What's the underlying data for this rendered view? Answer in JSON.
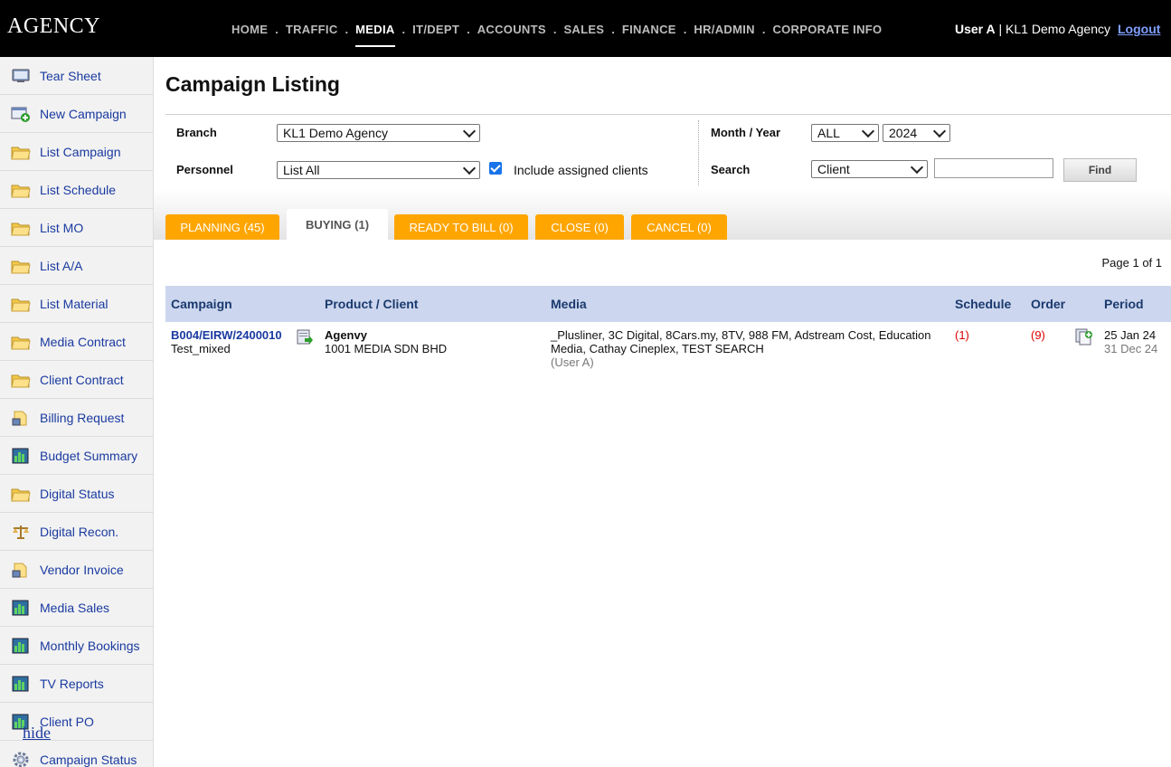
{
  "app": {
    "logo": "AGENCY"
  },
  "nav": {
    "items": [
      "HOME",
      "TRAFFIC",
      "MEDIA",
      "IT/DEPT",
      "ACCOUNTS",
      "SALES",
      "FINANCE",
      "HR/ADMIN",
      "CORPORATE INFO"
    ],
    "separator": ".",
    "active": "MEDIA"
  },
  "user": {
    "name": "User A",
    "divider": "|",
    "agency": "KL1 Demo Agency",
    "logout": "Logout"
  },
  "sidebar": {
    "items": [
      {
        "label": "Tear Sheet",
        "icon": "monitor-icon"
      },
      {
        "label": "New Campaign",
        "icon": "new-document-icon"
      },
      {
        "label": "List Campaign",
        "icon": "folder-icon"
      },
      {
        "label": "List Schedule",
        "icon": "folder-icon"
      },
      {
        "label": "List MO",
        "icon": "folder-icon"
      },
      {
        "label": "List A/A",
        "icon": "folder-icon"
      },
      {
        "label": "List Material",
        "icon": "folder-icon"
      },
      {
        "label": "Media Contract",
        "icon": "folder-icon"
      },
      {
        "label": "Client Contract",
        "icon": "folder-icon"
      },
      {
        "label": "Billing Request",
        "icon": "folder-lock-icon"
      },
      {
        "label": "Budget Summary",
        "icon": "bar-chart-icon"
      },
      {
        "label": "Digital Status",
        "icon": "folder-icon"
      },
      {
        "label": "Digital Recon.",
        "icon": "scale-icon"
      },
      {
        "label": "Vendor Invoice",
        "icon": "folder-lock-icon"
      },
      {
        "label": "Media Sales",
        "icon": "bar-chart-icon"
      },
      {
        "label": "Monthly Bookings",
        "icon": "bar-chart-icon"
      },
      {
        "label": "TV Reports",
        "icon": "bar-chart-icon"
      },
      {
        "label": "Client PO",
        "icon": "bar-chart-icon"
      },
      {
        "label": "Campaign Status",
        "icon": "gear-icon"
      }
    ],
    "hide_link": "hide"
  },
  "page": {
    "title": "Campaign Listing"
  },
  "filters": {
    "branch": {
      "label": "Branch",
      "value": "KL1 Demo Agency"
    },
    "personnel": {
      "label": "Personnel",
      "value": "List All"
    },
    "include_assigned": {
      "label": "Include assigned clients",
      "checked": true
    },
    "month_year": {
      "label": "Month / Year",
      "month": "ALL",
      "year": "2024"
    },
    "search": {
      "label": "Search",
      "field": "Client",
      "text": "",
      "button": "Find"
    }
  },
  "tabs": [
    {
      "label": "PLANNING (45)",
      "active": false
    },
    {
      "label": "BUYING (1)",
      "active": true
    },
    {
      "label": "READY TO BILL (0)",
      "active": false
    },
    {
      "label": "CLOSE (0)",
      "active": false
    },
    {
      "label": "CANCEL (0)",
      "active": false
    }
  ],
  "pager": {
    "text": "Page 1 of 1"
  },
  "table": {
    "headers": {
      "campaign": "Campaign",
      "product_client": "Product / Client",
      "media": "Media",
      "schedule": "Schedule",
      "order": "Order",
      "period": "Period"
    },
    "rows": [
      {
        "campaign_no": "B004/EIRW/2400010",
        "campaign_name": "Test_mixed",
        "product": "Agenvy",
        "client": "1001 MEDIA SDN BHD",
        "media_line1": "_Plusliner, 3C Digital, 8Cars.my, 8TV, 988 FM, Adstream Cost, Education",
        "media_line2": "Media, Cathay Cineplex, TEST SEARCH",
        "media_user": "(User A)",
        "schedule": "(1)",
        "order": "(9)",
        "period_start": "25 Jan 24",
        "period_end": "31 Dec 24"
      }
    ]
  },
  "colors": {
    "tab_orange": "#ffa500",
    "header_blue": "#ccd6ee",
    "link_blue": "#1a3aa0",
    "alert_red": "#dd0000"
  }
}
